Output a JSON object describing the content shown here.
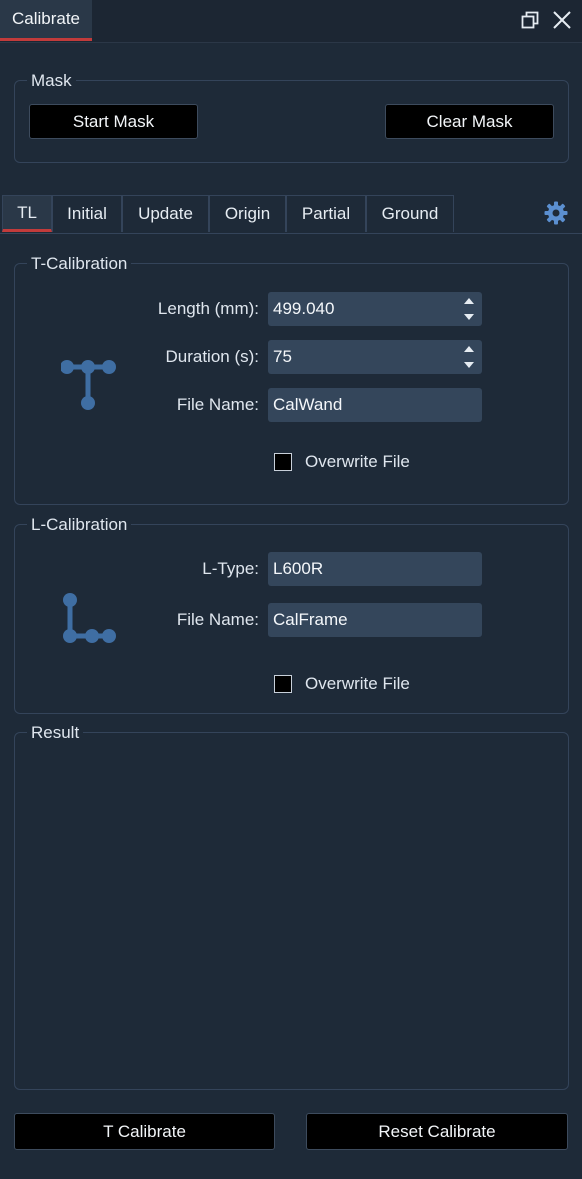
{
  "window": {
    "title": "Calibrate",
    "restore_icon": "restore-window-icon",
    "close_icon": "close-icon"
  },
  "mask": {
    "label": "Mask",
    "start_button": "Start Mask",
    "clear_button": "Clear Mask"
  },
  "tabs": [
    {
      "label": "TL",
      "active": true
    },
    {
      "label": "Initial"
    },
    {
      "label": "Update"
    },
    {
      "label": "Origin"
    },
    {
      "label": "Partial"
    },
    {
      "label": "Ground"
    }
  ],
  "settings_icon": "gear-icon",
  "t_calibration": {
    "label": "T-Calibration",
    "icon": "t-wand-icon",
    "length_label": "Length (mm):",
    "length_value": "499.040",
    "duration_label": "Duration (s):",
    "duration_value": "75",
    "filename_label": "File Name:",
    "filename_value": "CalWand",
    "overwrite_label": "Overwrite File",
    "overwrite_checked": false
  },
  "l_calibration": {
    "label": "L-Calibration",
    "icon": "l-frame-icon",
    "ltype_label": "L-Type:",
    "ltype_value": "L600R",
    "filename_label": "File Name:",
    "filename_value": "CalFrame",
    "overwrite_label": "Overwrite File",
    "overwrite_checked": false
  },
  "result": {
    "label": "Result"
  },
  "footer": {
    "t_calibrate_button": "T Calibrate",
    "reset_calibrate_button": "Reset Calibrate"
  },
  "colors": {
    "background": "#1e2a38",
    "accent": "#c23b3b",
    "field": "#34465b",
    "icon": "#3f6ea3"
  }
}
